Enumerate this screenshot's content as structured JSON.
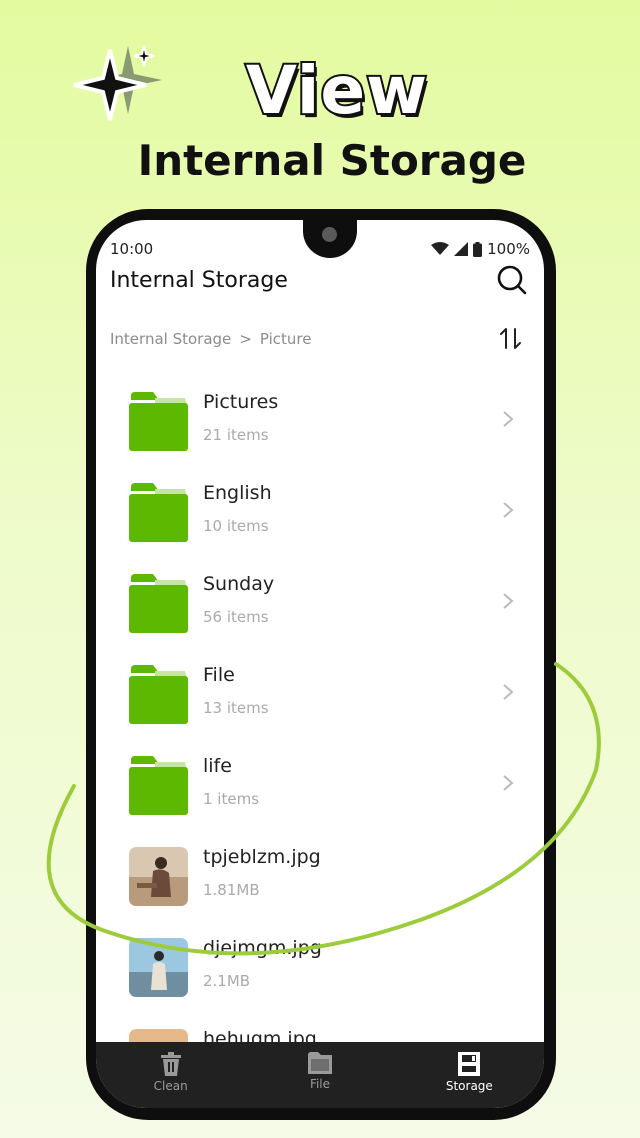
{
  "promo": {
    "headline": "View",
    "subheadline": "Internal Storage"
  },
  "status_bar": {
    "time": "10:00",
    "battery": "100%"
  },
  "app_bar": {
    "title": "Internal Storage",
    "search_icon": "search-icon"
  },
  "breadcrumb": {
    "root": "Internal Storage",
    "separator": ">",
    "current": "Picture",
    "sort_icon": "sort-icon"
  },
  "items": [
    {
      "type": "folder",
      "name": "Pictures",
      "meta": "21 items"
    },
    {
      "type": "folder",
      "name": "English",
      "meta": "10 items"
    },
    {
      "type": "folder",
      "name": "Sunday",
      "meta": "56 items"
    },
    {
      "type": "folder",
      "name": "File",
      "meta": "13 items"
    },
    {
      "type": "folder",
      "name": "life",
      "meta": "1 items"
    },
    {
      "type": "image",
      "name": "tpjeblzm.jpg",
      "meta": "1.81MB"
    },
    {
      "type": "image",
      "name": "djejmgm.jpg",
      "meta": "2.1MB"
    },
    {
      "type": "image",
      "name": "hehugm.jpg",
      "meta": ""
    }
  ],
  "bottom_nav": {
    "clean": "Clean",
    "file": "File",
    "storage": "Storage",
    "active": "storage"
  },
  "colors": {
    "accent": "#5cb800",
    "folder_tab": "#c6e5a3",
    "nav_bg": "#212121",
    "swoosh": "#9ccc3c"
  }
}
